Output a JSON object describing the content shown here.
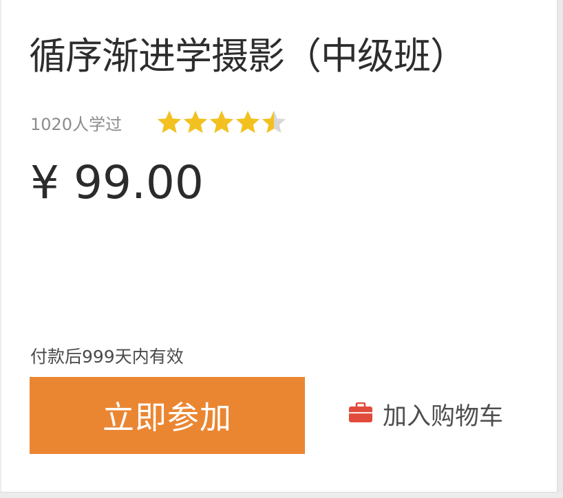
{
  "course": {
    "title": "循序渐进学摄影（中级班）",
    "learners_text": "1020人学过",
    "rating": 4.5,
    "rating_max": 5,
    "price": "¥ 99.00",
    "validity_text": "付款后999天内有效"
  },
  "actions": {
    "join_label": "立即参加",
    "cart_label": "加入购物车"
  },
  "colors": {
    "accent": "#ea8632",
    "star_filled": "#f3c11f",
    "star_empty": "#d8d8d8",
    "cart_icon": "#e14b3b"
  },
  "icons": {
    "rating": "star-icon",
    "cart": "briefcase-icon"
  }
}
